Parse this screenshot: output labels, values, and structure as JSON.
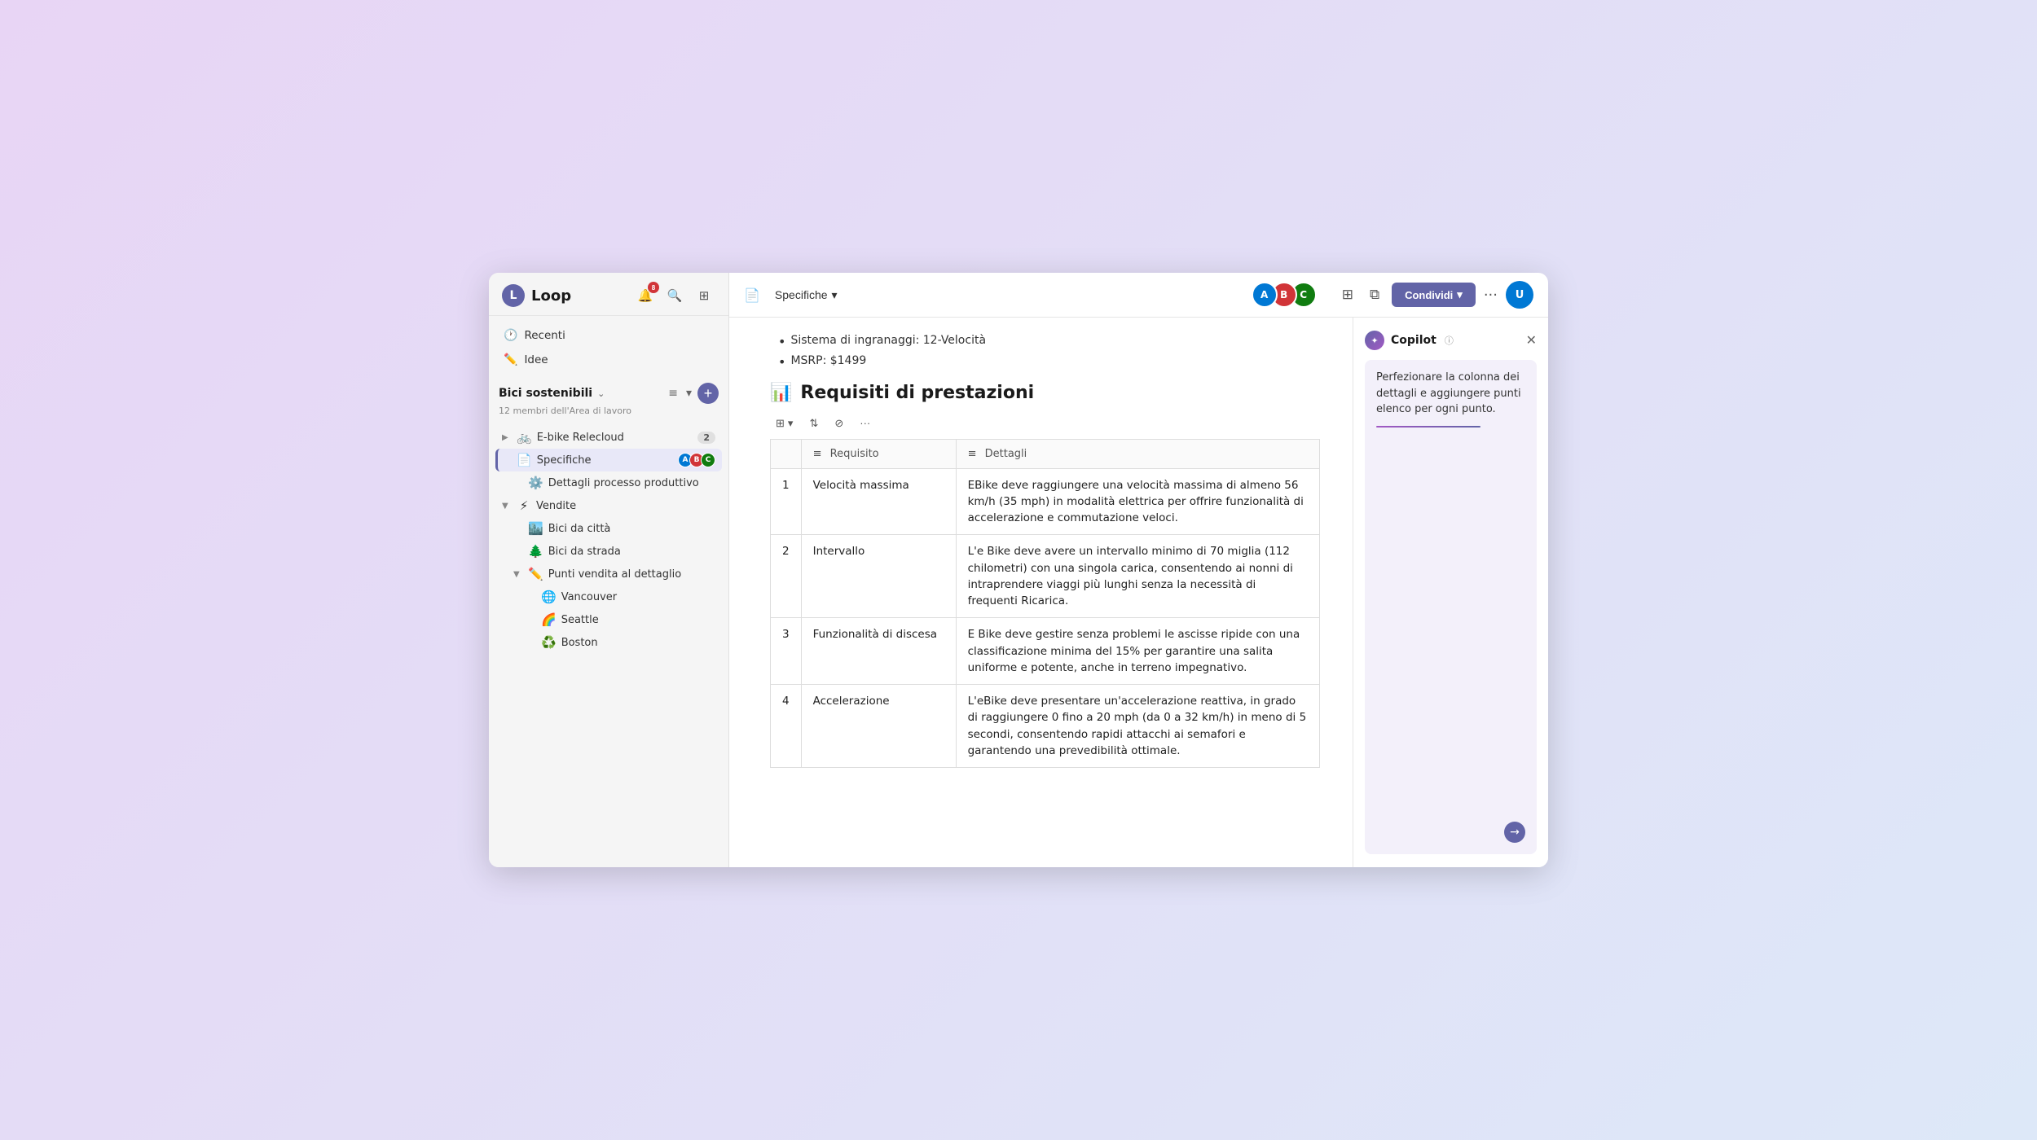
{
  "app": {
    "logo_text": "L",
    "title": "Loop"
  },
  "topbar": {
    "page_icon": "📄",
    "page_title": "Specifiche",
    "share_label": "Condividi",
    "share_chevron": "▾"
  },
  "sidebar": {
    "workspace_name": "Bici sostenibili",
    "workspace_members": "12 membri dell'Area di lavoro",
    "nav_items": [
      {
        "icon": "🕐",
        "label": "Recenti"
      },
      {
        "icon": "✏️",
        "label": "Idee"
      }
    ],
    "tree_items": [
      {
        "id": "ebike",
        "indent": 0,
        "chevron": "▶",
        "icon": "🚲",
        "label": "E-bike Relecloud",
        "badge": "2"
      },
      {
        "id": "specifiche",
        "indent": 1,
        "chevron": "",
        "icon": "📄",
        "label": "Specifiche",
        "active": true
      },
      {
        "id": "dettagli",
        "indent": 1,
        "chevron": "",
        "icon": "⚙️",
        "label": "Dettagli processo produttivo",
        "active": false
      },
      {
        "id": "vendite",
        "indent": 0,
        "chevron": "▼",
        "icon": "⚡",
        "label": "Vendite",
        "active": false
      },
      {
        "id": "bici-citta",
        "indent": 1,
        "chevron": "",
        "icon": "🏙️",
        "label": "Bici da città",
        "active": false
      },
      {
        "id": "bici-strada",
        "indent": 1,
        "chevron": "",
        "icon": "🌲",
        "label": "Bici da strada",
        "active": false
      },
      {
        "id": "punti-vendita",
        "indent": 1,
        "chevron": "▼",
        "icon": "✏️",
        "label": "Punti vendita al dettaglio",
        "active": false
      },
      {
        "id": "vancouver",
        "indent": 2,
        "chevron": "",
        "icon": "🌐",
        "label": "Vancouver",
        "active": false
      },
      {
        "id": "seattle",
        "indent": 2,
        "chevron": "",
        "icon": "🌈",
        "label": "Seattle",
        "active": false
      },
      {
        "id": "boston",
        "indent": 2,
        "chevron": "",
        "icon": "♻️",
        "label": "Boston",
        "active": false
      }
    ]
  },
  "doc": {
    "bullet_items": [
      "Sistema di ingranaggi: 12-Velocità",
      "MSRP: $1499"
    ],
    "section_title": "Requisiti di prestazioni",
    "section_icon": "📊"
  },
  "table": {
    "col_req": "Requisito",
    "col_details": "Dettagli",
    "rows": [
      {
        "num": "1",
        "req": "Velocità massima",
        "detail": "EBike deve raggiungere una velocità massima di almeno 56 km/h (35 mph) in modalità elettrica per offrire funzionalità di accelerazione e commutazione veloci."
      },
      {
        "num": "2",
        "req": "Intervallo",
        "detail": "L'e Bike deve avere un intervallo minimo di 70 miglia (112 chilometri) con una singola carica, consentendo ai nonni di intraprendere viaggi più lunghi senza la necessità di frequenti Ricarica."
      },
      {
        "num": "3",
        "req": "Funzionalità di discesa",
        "detail": "E Bike deve gestire senza problemi le ascisse ripide con una classificazione minima del 15% per garantire una salita uniforme e potente, anche in terreno impegnativo."
      },
      {
        "num": "4",
        "req": "Accelerazione",
        "detail": "L'eBike deve presentare un'accelerazione reattiva, in grado di raggiungere 0 fino a 20 mph (da 0 a 32 km/h) in meno di 5 secondi, consentendo rapidi attacchi ai semafori e garantendo una prevedibilità ottimale."
      }
    ]
  },
  "copilot": {
    "title": "Copilot",
    "info_icon": "ⓘ",
    "message": "Perfezionare la colonna dei dettagli e aggiungere punti elenco per ogni punto.",
    "arrow": "→"
  },
  "notifications": {
    "badge": "8"
  }
}
